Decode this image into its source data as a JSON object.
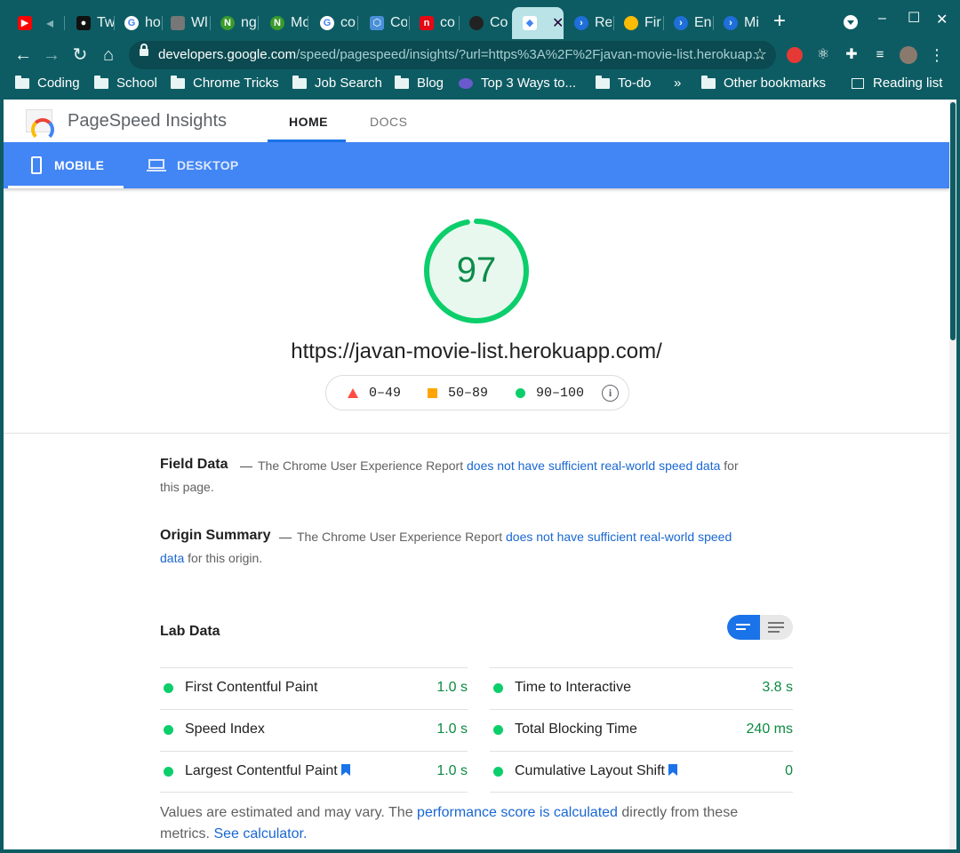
{
  "browser": {
    "tabs": [
      {
        "label": "",
        "icon": "youtube-icon"
      },
      {
        "label": "Tw",
        "icon": "tw-icon"
      },
      {
        "label": "ho",
        "icon": "google-icon"
      },
      {
        "label": "Wl",
        "icon": "wl-icon"
      },
      {
        "label": "ng",
        "icon": "n-icon"
      },
      {
        "label": "Mc",
        "icon": "n-icon"
      },
      {
        "label": "co",
        "icon": "google-icon"
      },
      {
        "label": "Co",
        "icon": "hex-icon"
      },
      {
        "label": "co",
        "icon": "netflix-icon"
      },
      {
        "label": "Co",
        "icon": "github-icon"
      },
      {
        "label": "",
        "icon": "psi-icon"
      },
      {
        "label": "Re",
        "icon": "terminal-icon"
      },
      {
        "label": "Fir",
        "icon": "chrome-icon"
      },
      {
        "label": "En",
        "icon": "terminal-icon"
      },
      {
        "label": "Mi",
        "icon": "terminal-icon"
      }
    ],
    "url_host": "developers.google.com",
    "url_path": "/speed/pagespeed/insights/?url=https%3A%2F%2Fjavan-movie-list.herokuap...",
    "bookmarks": [
      "Coding",
      "School",
      "Chrome Tricks",
      "Job Search",
      "Blog",
      "Top 3 Ways to...",
      "To-do",
      "Other bookmarks",
      "Reading list"
    ],
    "overflow": "»"
  },
  "header": {
    "brand": "PageSpeed Insights",
    "tabs": [
      "HOME",
      "DOCS"
    ]
  },
  "device": {
    "tabs": [
      "MOBILE",
      "DESKTOP"
    ]
  },
  "score": {
    "value": "97",
    "fraction": 0.97,
    "url": "https://javan-movie-list.herokuapp.com/",
    "legend": [
      "0–49",
      "50–89",
      "90–100"
    ],
    "colors": {
      "fail": "#ff4e42",
      "average": "#ffa400",
      "pass": "#0cce6b"
    }
  },
  "field_data": {
    "title": "Field Data",
    "text_before": "The Chrome User Experience Report",
    "link": "does not have sufficient real-world speed data",
    "text_after": "for this page."
  },
  "origin_summary": {
    "title": "Origin Summary",
    "text_before": "The Chrome User Experience Report",
    "link": "does not have sufficient real-world speed data",
    "text_after": "for this origin."
  },
  "lab_data": {
    "title": "Lab Data",
    "metrics_left": [
      {
        "name": "First Contentful Paint",
        "value": "1.0 s",
        "flag": false
      },
      {
        "name": "Speed Index",
        "value": "1.0 s",
        "flag": false
      },
      {
        "name": "Largest Contentful Paint",
        "value": "1.0 s",
        "flag": true
      }
    ],
    "metrics_right": [
      {
        "name": "Time to Interactive",
        "value": "3.8 s",
        "flag": false
      },
      {
        "name": "Total Blocking Time",
        "value": "240 ms",
        "flag": false
      },
      {
        "name": "Cumulative Layout Shift",
        "value": "0",
        "flag": true
      }
    ],
    "footnote_before": "Values are estimated and may vary. The",
    "footnote_link1": "performance score is calculated",
    "footnote_middle": "directly from these metrics.",
    "footnote_link2": "See calculator."
  }
}
